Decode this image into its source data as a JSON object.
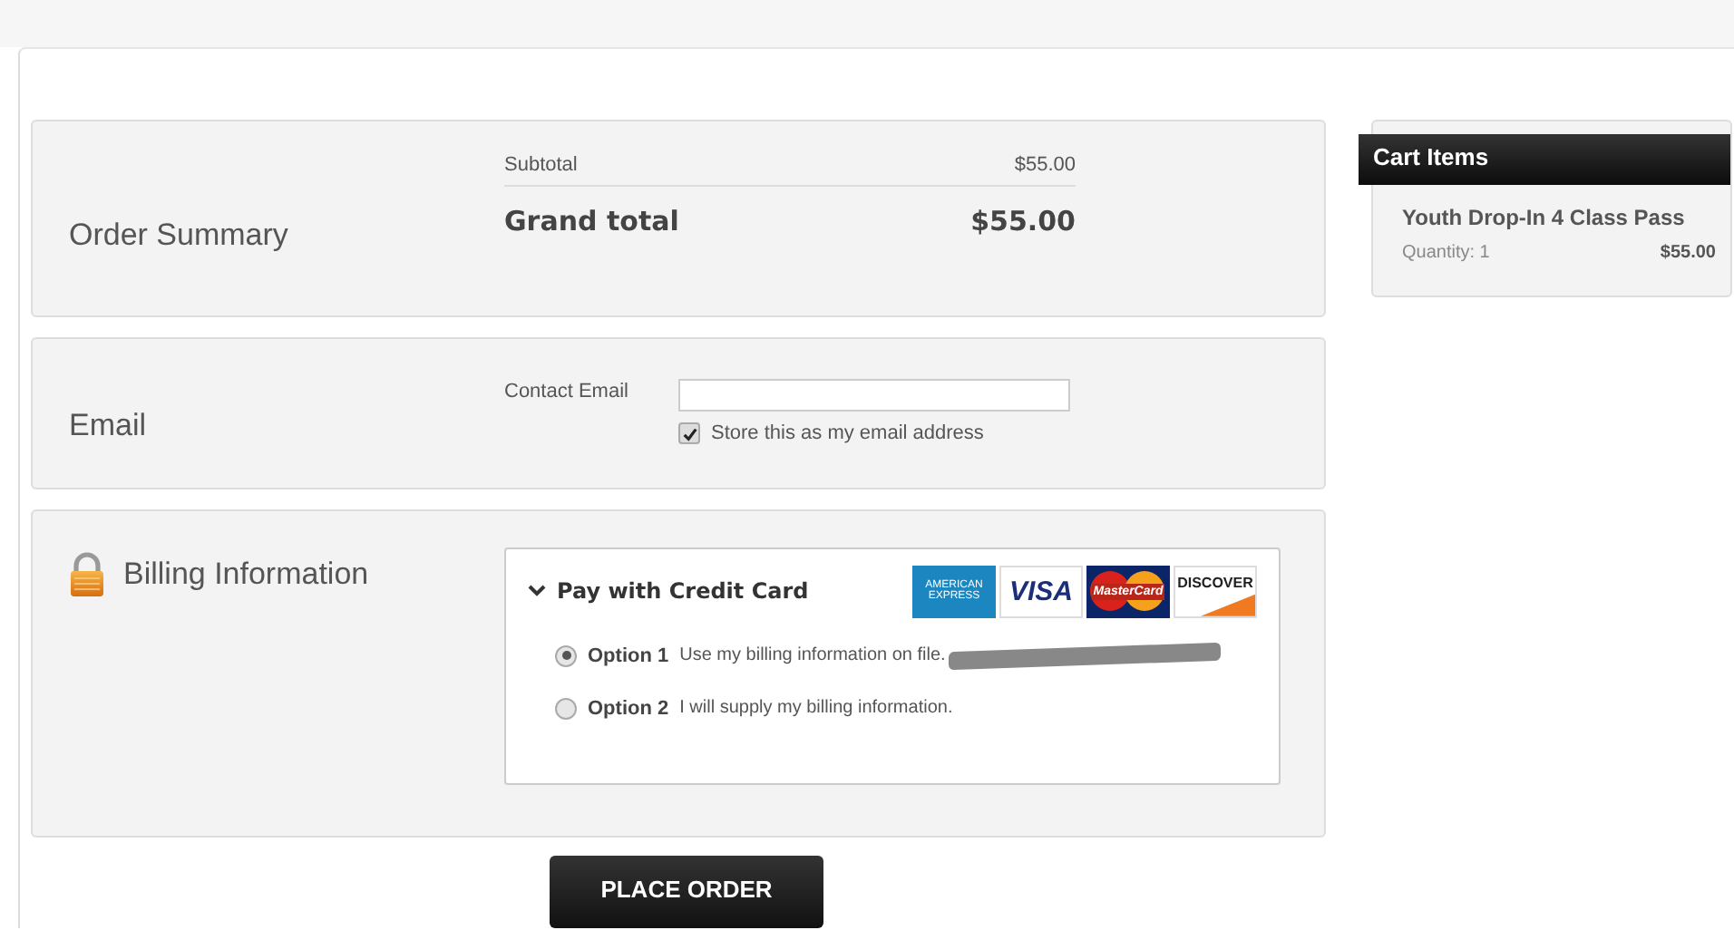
{
  "order_summary": {
    "title": "Order Summary",
    "subtotal_label": "Subtotal",
    "subtotal": "$55.00",
    "grand_total_label": "Grand total",
    "grand_total": "$55.00"
  },
  "email": {
    "title": "Email",
    "field_label": "Contact Email",
    "store_label": "Store this as my email address",
    "checked": true
  },
  "billing": {
    "title": "Billing Information",
    "method_title": "Pay with Credit Card",
    "expanded": true,
    "cards": [
      {
        "kind": "amex",
        "label": "AMERICAN EXPRESS"
      },
      {
        "kind": "visa",
        "label": "VISA"
      },
      {
        "kind": "mastercard",
        "label": "MasterCard"
      },
      {
        "kind": "discover",
        "label": "DISCOVER"
      }
    ],
    "options": [
      {
        "name": "Option 1",
        "text": "Use my billing information on file.",
        "selected": true,
        "redacted": true
      },
      {
        "name": "Option 2",
        "text": "I will supply my billing information.",
        "selected": false,
        "redacted": false
      }
    ]
  },
  "place_order": "PLACE ORDER",
  "cart": {
    "title": "Cart Items",
    "items": [
      {
        "name": "Youth Drop-In 4 Class Pass",
        "quantity": "Quantity: 1",
        "price": "$55.00"
      }
    ]
  }
}
